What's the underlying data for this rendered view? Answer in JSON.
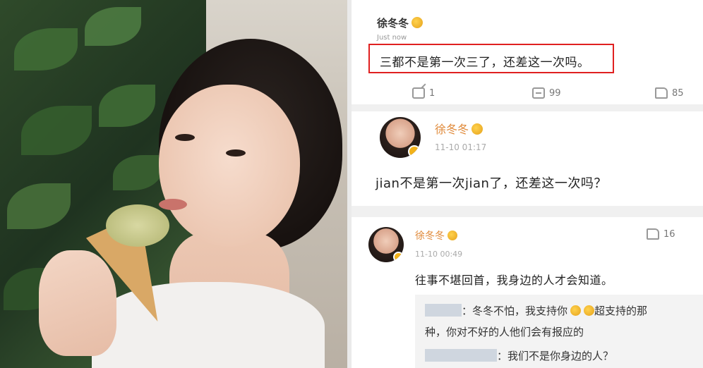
{
  "comment1": {
    "user": "徐冬冬",
    "time": "Just now",
    "text": "三都不是第一次三了，还差这一次吗。",
    "repost_count": "1",
    "comment_count": "99",
    "like_count": "85"
  },
  "comment2": {
    "user": "徐冬冬",
    "time": "11-10 01:17",
    "text": "jian不是第一次jian了，还差这一次吗？"
  },
  "comment3": {
    "user": "徐冬冬",
    "time": "11-10 00:49",
    "like_count": "16",
    "text": "往事不堪回首，我身边的人才会知道。",
    "replies": [
      {
        "text_line1": "：冬冬不怕，我支持你",
        "text_line1b": "超支持的那",
        "text_line2": "种，你对不好的人他们会有报应的"
      },
      {
        "text": "：我们不是你身边的人？"
      }
    ]
  },
  "colors": {
    "highlight": "#e02020",
    "username_orange": "#e08a3a",
    "badge": "#f2b21a"
  }
}
